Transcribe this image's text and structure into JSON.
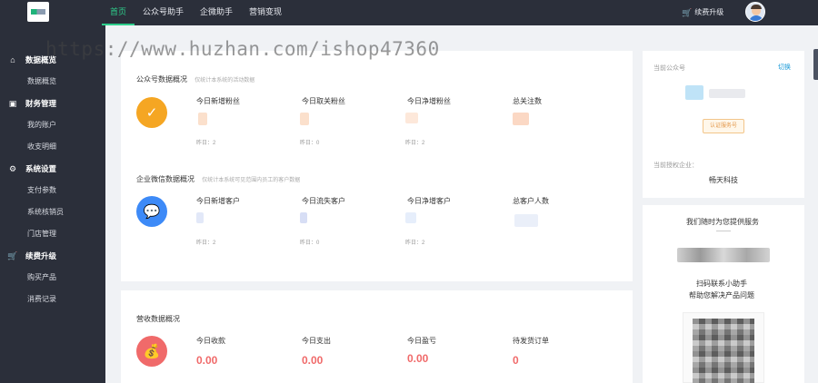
{
  "topnav": {
    "items": [
      {
        "label": "首页"
      },
      {
        "label": "公众号助手"
      },
      {
        "label": "企微助手"
      },
      {
        "label": "营销变现"
      }
    ],
    "renew_label": "续费升级"
  },
  "watermark": "https://www.huzhan.com/ishop47360",
  "sidebar": {
    "groups": [
      {
        "label": "数据概览",
        "icon": "home-icon",
        "items": [
          {
            "label": "数据概览"
          }
        ]
      },
      {
        "label": "财务管理",
        "icon": "wallet-icon",
        "items": [
          {
            "label": "我的账户"
          },
          {
            "label": "收支明细"
          }
        ]
      },
      {
        "label": "系统设置",
        "icon": "gear-icon",
        "items": [
          {
            "label": "支付参数"
          },
          {
            "label": "系统核销员"
          },
          {
            "label": "门店管理"
          }
        ]
      },
      {
        "label": "续费升级",
        "icon": "cart-icon",
        "items": [
          {
            "label": "购买产品"
          },
          {
            "label": "消费记录"
          }
        ]
      }
    ]
  },
  "mp_overview": {
    "title": "公众号数据概况",
    "subtitle": "仅统计本系统的活动数据",
    "icon": "shield-check-icon",
    "icon_color": "#f5a623",
    "stats": [
      {
        "label": "今日新增粉丝",
        "yesterday": "昨日：2"
      },
      {
        "label": "今日取关粉丝",
        "yesterday": "昨日：0"
      },
      {
        "label": "今日净增粉丝",
        "yesterday": "昨日：2"
      },
      {
        "label": "总关注数",
        "yesterday": ""
      }
    ]
  },
  "wecom_overview": {
    "title": "企业微信数据概况",
    "subtitle": "仅统计本系统可见范围内员工的客户数据",
    "icon": "chat-icon",
    "icon_color": "#3d8af7",
    "stats": [
      {
        "label": "今日新增客户",
        "yesterday": "昨日：2"
      },
      {
        "label": "今日流失客户",
        "yesterday": "昨日：0"
      },
      {
        "label": "今日净增客户",
        "yesterday": "昨日：2"
      },
      {
        "label": "总客户人数",
        "yesterday": ""
      }
    ]
  },
  "revenue_overview": {
    "title": "营收数据概况",
    "icon": "money-bag-icon",
    "icon_color": "#f06a6a",
    "stats": [
      {
        "label": "今日收款",
        "value": "0.00"
      },
      {
        "label": "今日支出",
        "value": "0.00"
      },
      {
        "label": "今日盈亏",
        "value": "0.00"
      },
      {
        "label": "待发货订单",
        "value": "0"
      }
    ]
  },
  "current_account": {
    "label": "当前公众号",
    "switch_label": "切换",
    "badge": "认证服务号",
    "authorized_label": "当前授权企业：",
    "company": "畅天科技"
  },
  "service": {
    "title": "我们随时为您提供服务",
    "line1": "扫码联系小助手",
    "line2": "帮助您解决产品问题"
  }
}
